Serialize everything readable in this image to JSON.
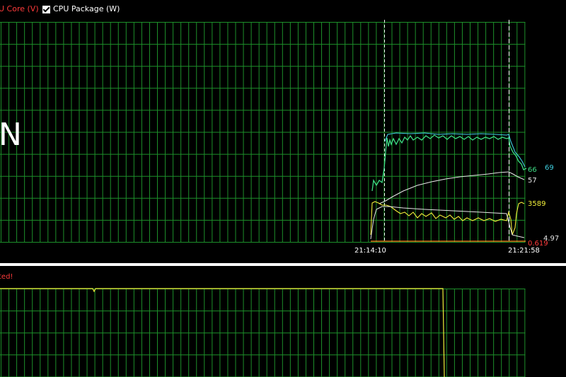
{
  "legend": {
    "item1_label": "U Core (V)",
    "item2_label": "CPU Package (W)",
    "item2_checked": true
  },
  "overlay_char": "N",
  "x_axis": {
    "marker1_time": "21:14:10",
    "marker2_time": "21:21:58"
  },
  "value_labels": [
    {
      "series": "cyan",
      "text": "69"
    },
    {
      "series": "green",
      "text": "66"
    },
    {
      "series": "white",
      "text": "57"
    },
    {
      "series": "yellow",
      "text": "3589"
    },
    {
      "series": "white2",
      "text": "4.97"
    },
    {
      "series": "red",
      "text": "0.619"
    }
  ],
  "lower_panel": {
    "warning_text": "ted!"
  },
  "colors": {
    "grid": "#1d8f2a",
    "green": "#3ddc84",
    "cyan": "#3fd0e0",
    "white": "#e6e6e6",
    "yellow": "#f2ef3a",
    "red": "#ff3b3b",
    "orange": "#ff8a1a"
  }
}
